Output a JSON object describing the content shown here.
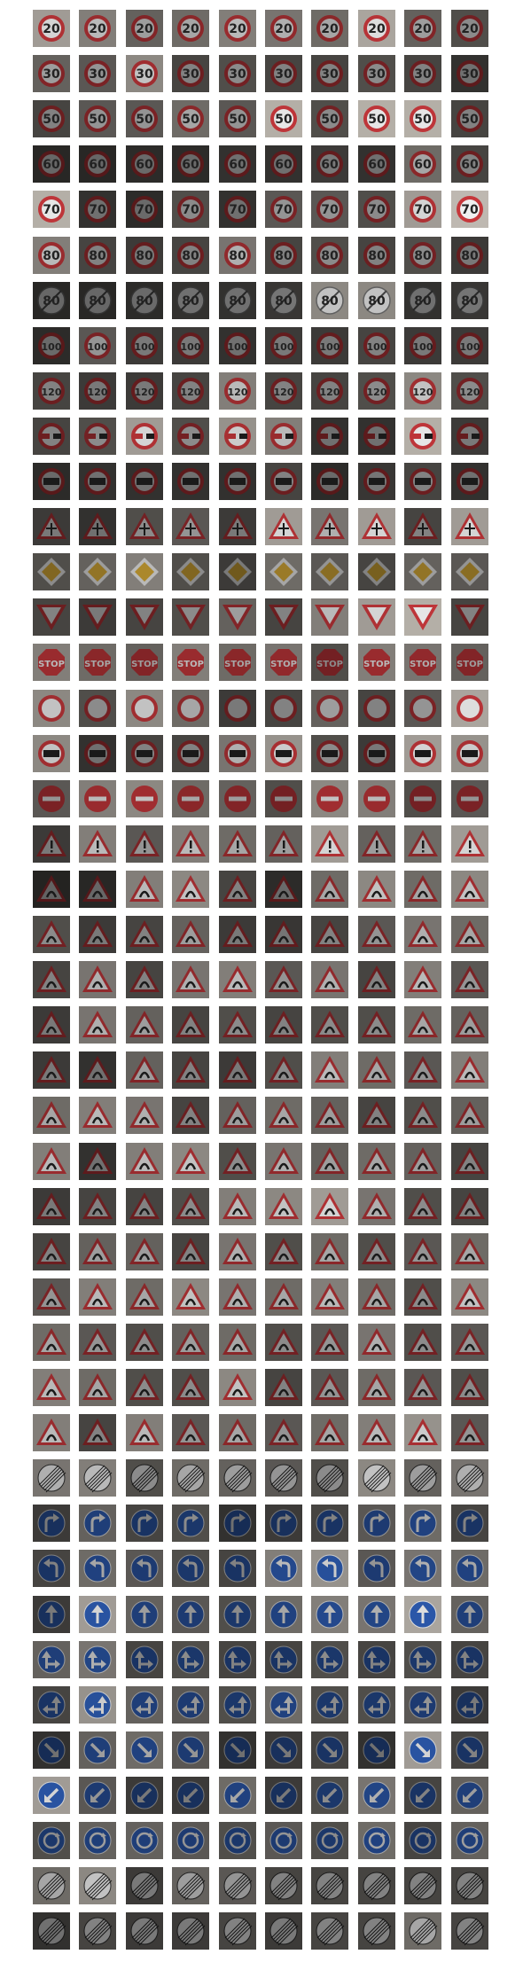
{
  "grid": {
    "columns": 10,
    "rows": 43,
    "row_classes": [
      {
        "class_id": 0,
        "shape": "circle-red",
        "symbol": "text",
        "text": "20",
        "lum": [
          0.7,
          0.55,
          0.4,
          0.45,
          0.55,
          0.5,
          0.45,
          0.75,
          0.4,
          0.3
        ]
      },
      {
        "class_id": 1,
        "shape": "circle-red",
        "symbol": "text",
        "text": "30",
        "lum": [
          0.4,
          0.35,
          0.6,
          0.25,
          0.3,
          0.25,
          0.25,
          0.3,
          0.25,
          0.15
        ]
      },
      {
        "class_id": 2,
        "shape": "circle-red",
        "symbol": "text",
        "text": "50",
        "lum": [
          0.25,
          0.35,
          0.35,
          0.45,
          0.35,
          0.8,
          0.3,
          0.8,
          0.8,
          0.25
        ]
      },
      {
        "class_id": 3,
        "shape": "circle-red",
        "symbol": "text",
        "text": "60",
        "lum": [
          0.1,
          0.1,
          0.12,
          0.12,
          0.15,
          0.15,
          0.2,
          0.15,
          0.45,
          0.25
        ]
      },
      {
        "class_id": 4,
        "shape": "circle-red",
        "symbol": "text",
        "text": "70",
        "lum": [
          0.8,
          0.15,
          0.12,
          0.3,
          0.15,
          0.35,
          0.35,
          0.3,
          0.7,
          0.85
        ]
      },
      {
        "class_id": 5,
        "shape": "circle-red",
        "symbol": "text",
        "text": "80",
        "lum": [
          0.55,
          0.25,
          0.2,
          0.25,
          0.5,
          0.25,
          0.3,
          0.25,
          0.3,
          0.2
        ]
      },
      {
        "class_id": 6,
        "shape": "circle-grey",
        "symbol": "text",
        "text": "80",
        "lum": [
          0.1,
          0.1,
          0.12,
          0.15,
          0.15,
          0.18,
          0.6,
          0.6,
          0.15,
          0.18
        ]
      },
      {
        "class_id": 7,
        "shape": "circle-red",
        "symbol": "text",
        "text": "100",
        "lum": [
          0.12,
          0.35,
          0.2,
          0.2,
          0.15,
          0.2,
          0.2,
          0.25,
          0.2,
          0.2
        ]
      },
      {
        "class_id": 8,
        "shape": "circle-red",
        "symbol": "text",
        "text": "120",
        "lum": [
          0.25,
          0.2,
          0.2,
          0.25,
          0.55,
          0.25,
          0.25,
          0.3,
          0.6,
          0.3
        ]
      },
      {
        "class_id": 9,
        "shape": "circle-red",
        "symbol": "cars",
        "text": "",
        "lum": [
          0.25,
          0.3,
          0.7,
          0.3,
          0.65,
          0.55,
          0.15,
          0.15,
          0.8,
          0.2
        ]
      },
      {
        "class_id": 10,
        "shape": "circle-red",
        "symbol": "truck",
        "text": "",
        "lum": [
          0.12,
          0.15,
          0.15,
          0.15,
          0.15,
          0.25,
          0.12,
          0.18,
          0.25,
          0.15
        ]
      },
      {
        "class_id": 11,
        "shape": "triangle-red",
        "symbol": "cross",
        "text": "",
        "lum": [
          0.2,
          0.15,
          0.3,
          0.35,
          0.2,
          0.7,
          0.5,
          0.7,
          0.25,
          0.7
        ]
      },
      {
        "class_id": 12,
        "shape": "diamond",
        "symbol": "",
        "text": "",
        "lum": [
          0.3,
          0.4,
          0.55,
          0.3,
          0.2,
          0.45,
          0.35,
          0.25,
          0.4,
          0.35
        ]
      },
      {
        "class_id": 13,
        "shape": "triangle-inv",
        "symbol": "",
        "text": "",
        "lum": [
          0.25,
          0.2,
          0.25,
          0.3,
          0.4,
          0.25,
          0.55,
          0.7,
          0.8,
          0.25
        ]
      },
      {
        "class_id": 14,
        "shape": "octagon",
        "symbol": "text",
        "text": "STOP",
        "lum": [
          0.55,
          0.45,
          0.4,
          0.55,
          0.45,
          0.5,
          0.3,
          0.55,
          0.5,
          0.4
        ]
      },
      {
        "class_id": 15,
        "shape": "circle-red",
        "symbol": "",
        "text": "",
        "lum": [
          0.6,
          0.3,
          0.6,
          0.45,
          0.2,
          0.25,
          0.4,
          0.25,
          0.35,
          0.75
        ]
      },
      {
        "class_id": 16,
        "shape": "circle-red",
        "symbol": "truck",
        "text": "",
        "lum": [
          0.6,
          0.15,
          0.25,
          0.25,
          0.5,
          0.65,
          0.3,
          0.2,
          0.7,
          0.65
        ]
      },
      {
        "class_id": 17,
        "shape": "noentry",
        "symbol": "",
        "text": "",
        "lum": [
          0.35,
          0.55,
          0.6,
          0.45,
          0.4,
          0.3,
          0.6,
          0.55,
          0.3,
          0.35
        ]
      },
      {
        "class_id": 18,
        "shape": "triangle-red",
        "symbol": "bang",
        "text": "",
        "lum": [
          0.2,
          0.55,
          0.35,
          0.55,
          0.45,
          0.4,
          0.7,
          0.4,
          0.45,
          0.7
        ]
      },
      {
        "class_id": 19,
        "shape": "triangle-red",
        "symbol": "curve",
        "text": "",
        "lum": [
          0.08,
          0.1,
          0.55,
          0.6,
          0.25,
          0.12,
          0.45,
          0.6,
          0.45,
          0.6
        ]
      },
      {
        "class_id": 20,
        "shape": "triangle-red",
        "symbol": "curve",
        "text": "",
        "lum": [
          0.3,
          0.2,
          0.25,
          0.4,
          0.2,
          0.18,
          0.25,
          0.35,
          0.5,
          0.45
        ]
      },
      {
        "class_id": 21,
        "shape": "triangle-red",
        "symbol": "curve",
        "text": "",
        "lum": [
          0.25,
          0.5,
          0.25,
          0.5,
          0.55,
          0.35,
          0.5,
          0.25,
          0.55,
          0.35
        ]
      },
      {
        "class_id": 22,
        "shape": "triangle-red",
        "symbol": "bump",
        "text": "",
        "lum": [
          0.2,
          0.5,
          0.4,
          0.25,
          0.3,
          0.25,
          0.3,
          0.3,
          0.45,
          0.4
        ]
      },
      {
        "class_id": 23,
        "shape": "triangle-red",
        "symbol": "curve",
        "text": "",
        "lum": [
          0.2,
          0.15,
          0.4,
          0.25,
          0.2,
          0.3,
          0.55,
          0.45,
          0.35,
          0.55
        ]
      },
      {
        "class_id": 24,
        "shape": "triangle-red",
        "symbol": "narrow",
        "text": "",
        "lum": [
          0.45,
          0.55,
          0.5,
          0.25,
          0.4,
          0.45,
          0.4,
          0.25,
          0.3,
          0.4
        ]
      },
      {
        "class_id": 25,
        "shape": "triangle-red",
        "symbol": "work",
        "text": "",
        "lum": [
          0.55,
          0.15,
          0.55,
          0.6,
          0.3,
          0.5,
          0.4,
          0.45,
          0.4,
          0.25
        ]
      },
      {
        "class_id": 26,
        "shape": "triangle-red",
        "symbol": "lights",
        "text": "",
        "lum": [
          0.2,
          0.25,
          0.25,
          0.3,
          0.55,
          0.6,
          0.7,
          0.5,
          0.3,
          0.25
        ]
      },
      {
        "class_id": 27,
        "shape": "triangle-red",
        "symbol": "ped",
        "text": "",
        "lum": [
          0.25,
          0.4,
          0.4,
          0.25,
          0.5,
          0.3,
          0.45,
          0.3,
          0.35,
          0.45
        ]
      },
      {
        "class_id": 28,
        "shape": "triangle-red",
        "symbol": "kids",
        "text": "",
        "lum": [
          0.35,
          0.55,
          0.45,
          0.6,
          0.5,
          0.45,
          0.55,
          0.45,
          0.3,
          0.6
        ]
      },
      {
        "class_id": 29,
        "shape": "triangle-red",
        "symbol": "bike",
        "text": "",
        "lum": [
          0.45,
          0.35,
          0.3,
          0.4,
          0.45,
          0.3,
          0.35,
          0.5,
          0.3,
          0.35
        ]
      },
      {
        "class_id": 30,
        "shape": "triangle-red",
        "symbol": "snow",
        "text": "",
        "lum": [
          0.55,
          0.45,
          0.3,
          0.3,
          0.6,
          0.25,
          0.35,
          0.45,
          0.35,
          0.3
        ]
      },
      {
        "class_id": 31,
        "shape": "triangle-red",
        "symbol": "deer",
        "text": "",
        "lum": [
          0.55,
          0.25,
          0.55,
          0.35,
          0.45,
          0.35,
          0.45,
          0.55,
          0.65,
          0.35
        ]
      },
      {
        "class_id": 32,
        "shape": "end",
        "symbol": "",
        "text": "",
        "lum": [
          0.5,
          0.55,
          0.3,
          0.45,
          0.4,
          0.35,
          0.3,
          0.6,
          0.4,
          0.5
        ]
      },
      {
        "class_id": 33,
        "shape": "circle-blue",
        "symbol": "turn-right",
        "text": "",
        "lum": [
          0.2,
          0.4,
          0.25,
          0.3,
          0.15,
          0.2,
          0.25,
          0.35,
          0.45,
          0.25
        ]
      },
      {
        "class_id": 34,
        "shape": "circle-blue",
        "symbol": "turn-left",
        "text": "",
        "lum": [
          0.25,
          0.45,
          0.35,
          0.3,
          0.25,
          0.55,
          0.65,
          0.35,
          0.5,
          0.45
        ]
      },
      {
        "class_id": 35,
        "shape": "circle-blue",
        "symbol": "up",
        "text": "",
        "lum": [
          0.2,
          0.7,
          0.4,
          0.35,
          0.3,
          0.45,
          0.55,
          0.5,
          0.75,
          0.4
        ]
      },
      {
        "class_id": 36,
        "shape": "circle-blue",
        "symbol": "up-right",
        "text": "",
        "lum": [
          0.4,
          0.5,
          0.25,
          0.3,
          0.25,
          0.25,
          0.3,
          0.25,
          0.3,
          0.25
        ]
      },
      {
        "class_id": 37,
        "shape": "circle-blue",
        "symbol": "up-left",
        "text": "",
        "lum": [
          0.25,
          0.65,
          0.4,
          0.35,
          0.3,
          0.45,
          0.3,
          0.3,
          0.35,
          0.2
        ]
      },
      {
        "class_id": 38,
        "shape": "circle-blue",
        "symbol": "keep-right",
        "text": "",
        "lum": [
          0.15,
          0.4,
          0.45,
          0.35,
          0.15,
          0.2,
          0.25,
          0.15,
          0.7,
          0.25
        ]
      },
      {
        "class_id": 39,
        "shape": "circle-blue",
        "symbol": "keep-left",
        "text": "",
        "lum": [
          0.7,
          0.35,
          0.2,
          0.2,
          0.45,
          0.2,
          0.3,
          0.5,
          0.25,
          0.4
        ]
      },
      {
        "class_id": 40,
        "shape": "circle-blue",
        "symbol": "round",
        "text": "",
        "lum": [
          0.3,
          0.4,
          0.4,
          0.35,
          0.3,
          0.35,
          0.3,
          0.45,
          0.25,
          0.4
        ]
      },
      {
        "class_id": 41,
        "shape": "end",
        "symbol": "",
        "text": "",
        "lum": [
          0.45,
          0.6,
          0.2,
          0.4,
          0.35,
          0.25,
          0.25,
          0.25,
          0.25,
          0.25
        ]
      },
      {
        "class_id": 42,
        "shape": "end",
        "symbol": "",
        "text": "",
        "lum": [
          0.15,
          0.25,
          0.2,
          0.2,
          0.25,
          0.2,
          0.25,
          0.25,
          0.45,
          0.25
        ]
      }
    ]
  },
  "colors": {
    "page_background": "#ffffff",
    "sign_red": "#c8383c",
    "sign_blue": "#2f5fb8",
    "sign_yellow": "#e0b23a",
    "sign_white": "#f2f2f2"
  }
}
